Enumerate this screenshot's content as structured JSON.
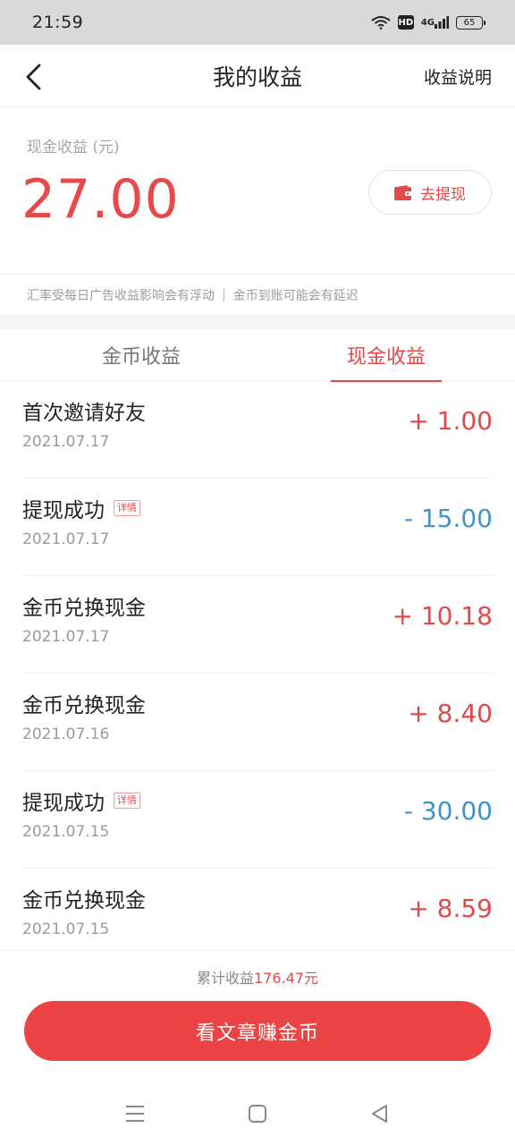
{
  "status": {
    "time": "21:59",
    "hd": "HD",
    "network": "4G",
    "battery": "65"
  },
  "nav": {
    "title": "我的收益",
    "right_link": "收益说明",
    "back_icon": "chevron-left-icon"
  },
  "balance": {
    "label": "现金收益 (元)",
    "value": "27.00",
    "withdraw_label": "去提现"
  },
  "notice": {
    "left": "汇率受每日广告收益影响会有浮动",
    "separator": "|",
    "right": "金币到账可能会有延迟"
  },
  "tabs": [
    {
      "label": "金币收益"
    },
    {
      "label": "现金收益"
    }
  ],
  "records": [
    {
      "title": "首次邀请好友",
      "date": "2021.07.17",
      "amount": "+ 1.00",
      "tag": ""
    },
    {
      "title": "提现成功",
      "date": "2021.07.17",
      "amount": "- 15.00",
      "tag": "详情"
    },
    {
      "title": "金币兑换现金",
      "date": "2021.07.17",
      "amount": "+ 10.18",
      "tag": ""
    },
    {
      "title": "金币兑换现金",
      "date": "2021.07.16",
      "amount": "+ 8.40",
      "tag": ""
    },
    {
      "title": "提现成功",
      "date": "2021.07.15",
      "amount": "- 30.00",
      "tag": "详情"
    },
    {
      "title": "金币兑换现金",
      "date": "2021.07.15",
      "amount": "+ 8.59",
      "tag": ""
    }
  ],
  "footer": {
    "total_prefix": "累计收益",
    "total_value": "176.47元",
    "cta_label": "看文章赚金币"
  },
  "colors": {
    "accent": "#e04a4a",
    "positive": "#e04a4a",
    "negative": "#3d95c8",
    "cta": "#ec4345"
  }
}
